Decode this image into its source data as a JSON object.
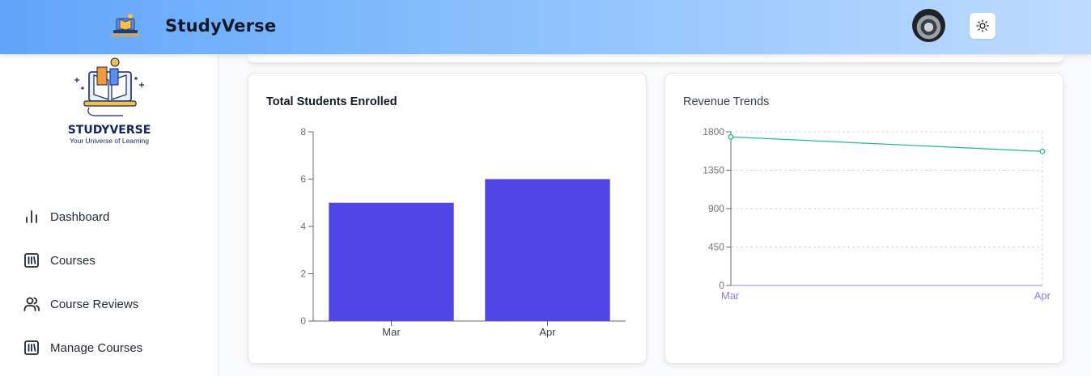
{
  "header": {
    "app_title": "StudyVerse",
    "logo_icon": "book-laptop-logo-icon",
    "avatar_icon": "user-avatar",
    "theme_icon": "sun-icon"
  },
  "sidebar": {
    "brand_name": "STUDYVERSE",
    "brand_tagline": "Your Universe of Learning",
    "items": [
      {
        "label": "Dashboard",
        "icon": "bar-chart-icon"
      },
      {
        "label": "Courses",
        "icon": "library-icon"
      },
      {
        "label": "Course Reviews",
        "icon": "users-icon"
      },
      {
        "label": "Manage Courses",
        "icon": "library-icon"
      }
    ]
  },
  "colors": {
    "bar": "#5046e5",
    "line": "#1ab97a",
    "x_tick_line_chart": "#8884d8"
  },
  "chart_data": [
    {
      "type": "bar",
      "title": "Total Students Enrolled",
      "categories": [
        "Mar",
        "Apr"
      ],
      "values": [
        5,
        6
      ],
      "ylim": [
        0,
        8
      ],
      "yticks": [
        0,
        2,
        4,
        6,
        8
      ],
      "grid": false,
      "xlabel": "",
      "ylabel": ""
    },
    {
      "type": "line",
      "title": "Revenue Trends",
      "x": [
        "Mar",
        "Apr"
      ],
      "values": [
        1740,
        1570
      ],
      "ylim": [
        0,
        1800
      ],
      "yticks": [
        0,
        450,
        900,
        1350,
        1800
      ],
      "grid": true,
      "xlabel": "",
      "ylabel": ""
    }
  ]
}
